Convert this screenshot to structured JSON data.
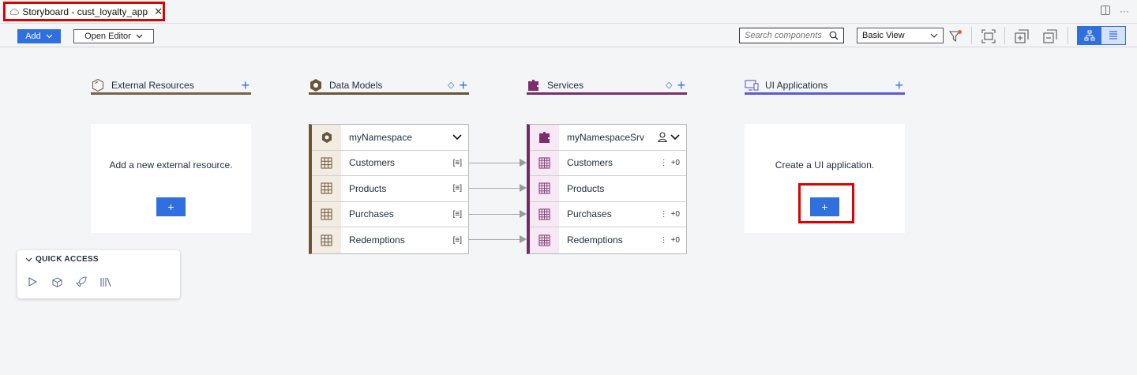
{
  "tab": {
    "title": "Storyboard - cust_loyalty_app",
    "close": "✕"
  },
  "tabbar_right": {
    "more": "···"
  },
  "toolbar": {
    "add_label": "Add",
    "open_editor_label": "Open Editor",
    "search_placeholder": "Search components",
    "view_select": "Basic View"
  },
  "columns": {
    "external": {
      "title": "External Resources",
      "empty_message": "Add a new external resource.",
      "add_button": "+"
    },
    "data_models": {
      "title": "Data Models"
    },
    "services": {
      "title": "Services"
    },
    "ui_apps": {
      "title": "UI Applications",
      "empty_message": "Create a UI application.",
      "add_button": "+"
    }
  },
  "data_model_card": {
    "namespace": "myNamespace",
    "entities": [
      "Customers",
      "Products",
      "Purchases",
      "Redemptions"
    ],
    "entity_badge": "[≡]"
  },
  "service_card": {
    "name": "myNamespaceSrv",
    "entities": [
      {
        "label": "Customers",
        "badge": "+0"
      },
      {
        "label": "Products",
        "badge": ""
      },
      {
        "label": "Purchases",
        "badge": "+0"
      },
      {
        "label": "Redemptions",
        "badge": "+0"
      }
    ]
  },
  "quick_access": {
    "title": "QUICK ACCESS"
  },
  "colors": {
    "accent": "#2f6fe0",
    "external_line": "#7a6148",
    "data_models_line": "#6b5438",
    "services_line": "#7b2d6e",
    "ui_apps_line": "#5b5bd6",
    "highlight": "#e00000"
  }
}
